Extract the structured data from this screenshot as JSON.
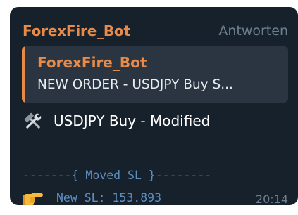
{
  "message": {
    "sender": "ForexFire_Bot",
    "reply_label": "Antworten",
    "quoted": {
      "sender": "ForexFire_Bot",
      "text": "NEW ORDER - USDJPY Buy S..."
    },
    "main_text": "USDJPY Buy - Modified",
    "separator": "-------{ Moved SL }--------",
    "sl_text": "New SL: 153.893",
    "time": "20:14"
  },
  "icons": {
    "tools": "hammer-wrench-icon",
    "hand": "pointing-hand-icon"
  },
  "colors": {
    "background": "#17212b",
    "accent": "#e88b48",
    "quote_background": "#2a3541",
    "mono_text": "#5b8fc2",
    "muted": "#6d7f8f"
  }
}
